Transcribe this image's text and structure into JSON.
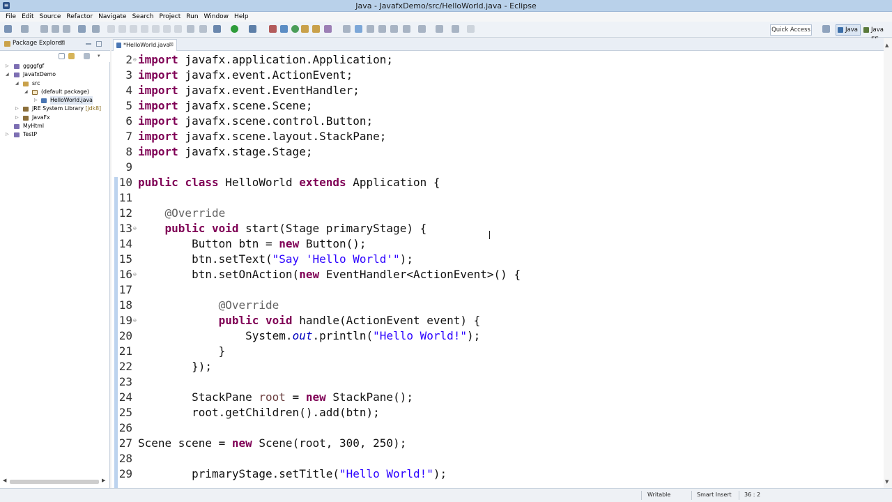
{
  "window": {
    "title": "Java - JavafxDemo/src/HelloWorld.java - Eclipse"
  },
  "menu": [
    "File",
    "Edit",
    "Source",
    "Refactor",
    "Navigate",
    "Search",
    "Project",
    "Run",
    "Window",
    "Help"
  ],
  "toolbar": {
    "quick_access": "Quick Access",
    "perspective_java": "Java",
    "perspective_java_ee": "Java EE"
  },
  "package_explorer": {
    "title": "Package Explorer",
    "tree": [
      {
        "label": "ggggfgf",
        "decoration": ""
      },
      {
        "label": "JavafxDemo",
        "decoration": ""
      },
      {
        "label": "src",
        "decoration": ""
      },
      {
        "label": "(default package)",
        "decoration": ""
      },
      {
        "label": "HelloWorld.java",
        "decoration": ""
      },
      {
        "label": "JRE System Library",
        "decoration": "[jdk8]"
      },
      {
        "label": "JavaFx",
        "decoration": ""
      },
      {
        "label": "MyHtml",
        "decoration": ""
      },
      {
        "label": "TestP",
        "decoration": ""
      }
    ]
  },
  "editor": {
    "tab_label": "*HelloWorld.java",
    "lines": [
      {
        "n": "2",
        "text": "import javafx.application.Application;"
      },
      {
        "n": "3",
        "text": "import javafx.event.ActionEvent;"
      },
      {
        "n": "4",
        "text": "import javafx.event.EventHandler;"
      },
      {
        "n": "5",
        "text": "import javafx.scene.Scene;"
      },
      {
        "n": "6",
        "text": "import javafx.scene.control.Button;"
      },
      {
        "n": "7",
        "text": "import javafx.scene.layout.StackPane;"
      },
      {
        "n": "8",
        "text": "import javafx.stage.Stage;"
      },
      {
        "n": "9",
        "text": ""
      },
      {
        "n": "10",
        "text": "public class HelloWorld extends Application {"
      },
      {
        "n": "11",
        "text": ""
      },
      {
        "n": "12",
        "text": "    @Override"
      },
      {
        "n": "13",
        "text": "    public void start(Stage primaryStage) {"
      },
      {
        "n": "14",
        "text": "        Button btn = new Button();"
      },
      {
        "n": "15",
        "text": "        btn.setText(\"Say 'Hello World'\");"
      },
      {
        "n": "16",
        "text": "        btn.setOnAction(new EventHandler<ActionEvent>() {"
      },
      {
        "n": "17",
        "text": ""
      },
      {
        "n": "18",
        "text": "            @Override"
      },
      {
        "n": "19",
        "text": "            public void handle(ActionEvent event) {"
      },
      {
        "n": "20",
        "text": "                System.out.println(\"Hello World!\");"
      },
      {
        "n": "21",
        "text": "            }"
      },
      {
        "n": "22",
        "text": "        });"
      },
      {
        "n": "23",
        "text": ""
      },
      {
        "n": "24",
        "text": "        StackPane root = new StackPane();"
      },
      {
        "n": "25",
        "text": "        root.getChildren().add(btn);"
      },
      {
        "n": "26",
        "text": ""
      },
      {
        "n": "27",
        "text": "Scene scene = new Scene(root, 300, 250);"
      },
      {
        "n": "28",
        "text": ""
      },
      {
        "n": "29",
        "text": "        primaryStage.setTitle(\"Hello World!\");"
      }
    ]
  },
  "statusbar": {
    "writable": "Writable",
    "insert_mode": "Smart Insert",
    "position": "36 : 2"
  }
}
